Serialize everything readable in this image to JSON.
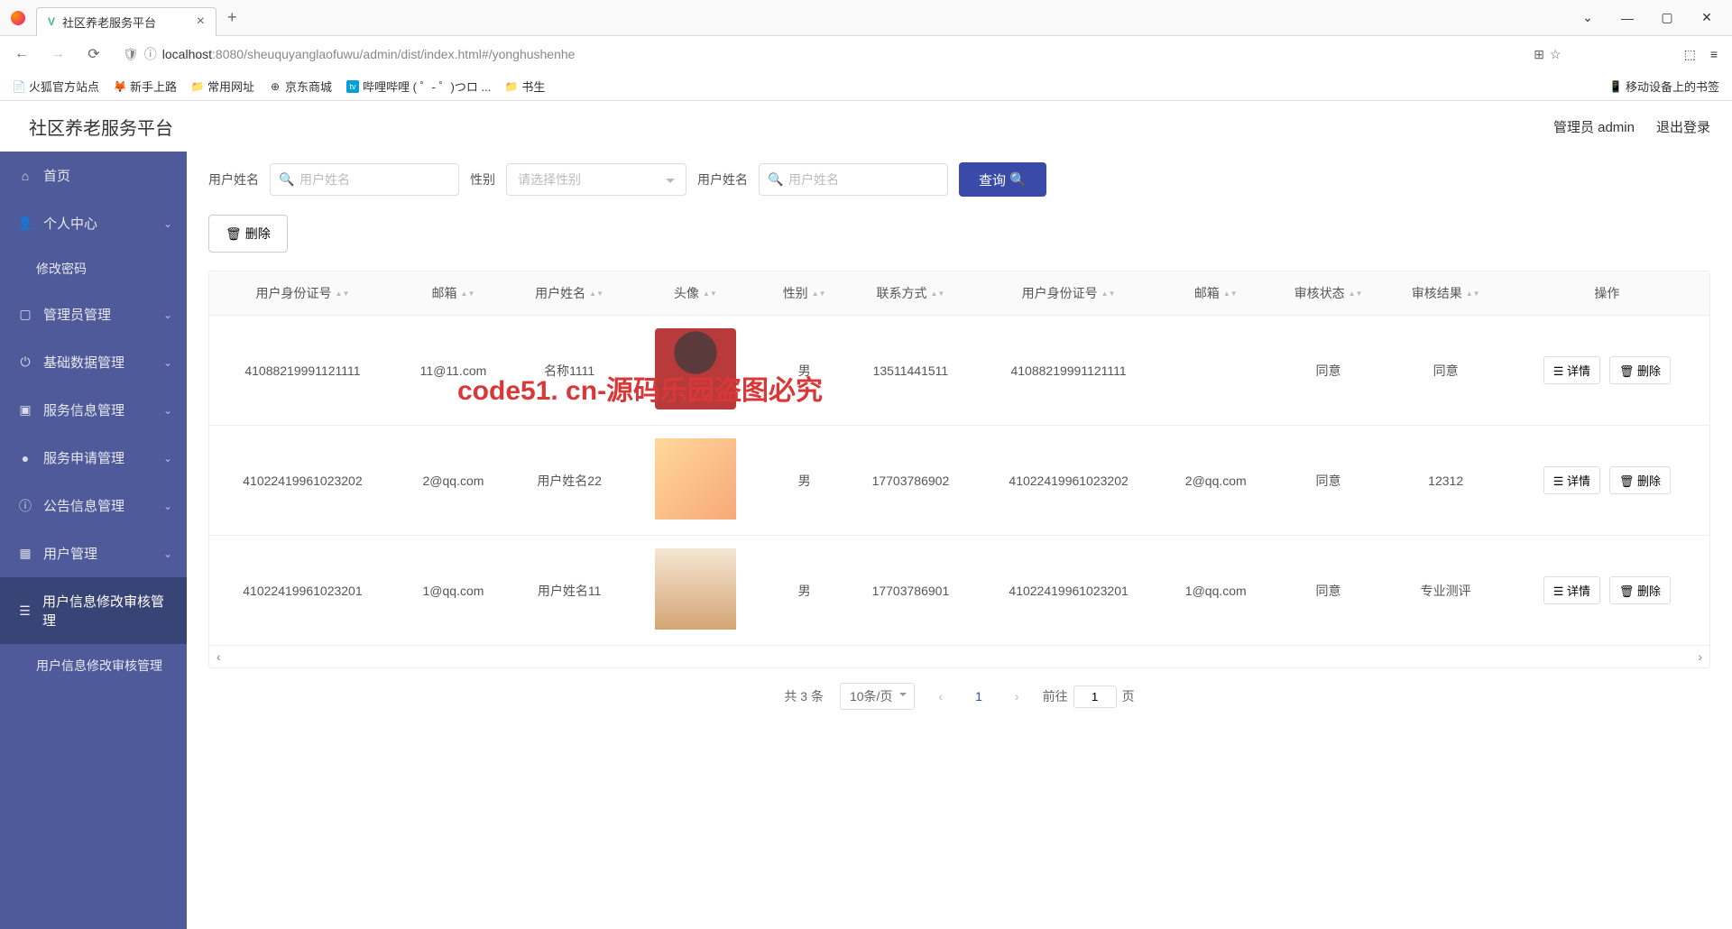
{
  "browser": {
    "tab_title": "社区养老服务平台",
    "url_host": "localhost",
    "url_rest": ":8080/sheuquyanglaofuwu/admin/dist/index.html#/yonghushenhe",
    "bookmarks": [
      "火狐官方站点",
      "新手上路",
      "常用网址",
      "京东商城",
      "哔哩哔哩 ( ゜- ゜)つロ ...",
      "书生"
    ],
    "mobile_bm": "移动设备上的书签"
  },
  "header": {
    "app_title": "社区养老服务平台",
    "admin_label": "管理员 admin",
    "logout": "退出登录"
  },
  "sidebar": {
    "items": [
      {
        "label": "首页",
        "icon": "home"
      },
      {
        "label": "个人中心",
        "icon": "user",
        "expand": true
      },
      {
        "label": "修改密码",
        "sub": true
      },
      {
        "label": "管理员管理",
        "icon": "square",
        "expand": true
      },
      {
        "label": "基础数据管理",
        "icon": "power",
        "expand": true
      },
      {
        "label": "服务信息管理",
        "icon": "box",
        "expand": true
      },
      {
        "label": "服务申请管理",
        "icon": "bulb",
        "expand": true
      },
      {
        "label": "公告信息管理",
        "icon": "info",
        "expand": true
      },
      {
        "label": "用户管理",
        "icon": "grid",
        "expand": true
      },
      {
        "label": "用户信息修改审核管理",
        "icon": "list",
        "active": true
      },
      {
        "label": "用户信息修改审核管理",
        "sub": true
      }
    ]
  },
  "filters": {
    "name_label1": "用户姓名",
    "name_ph1": "用户姓名",
    "sex_label": "性别",
    "sex_ph": "请选择性别",
    "name_label2": "用户姓名",
    "name_ph2": "用户姓名",
    "search_btn": "查询",
    "delete_btn": "删除"
  },
  "table": {
    "headers": [
      "用户身份证号",
      "邮箱",
      "用户姓名",
      "头像",
      "性别",
      "联系方式",
      "用户身份证号",
      "邮箱",
      "审核状态",
      "审核结果",
      "操作"
    ],
    "op_detail": "详情",
    "op_delete": "删除",
    "rows": [
      {
        "id1": "41088219991121111",
        "email1": "11@11.com",
        "name": "名称1111",
        "sex": "男",
        "phone": "13511441511",
        "id2": "41088219991121111",
        "email2": "",
        "status": "同意",
        "result": "同意"
      },
      {
        "id1": "41022419961023202",
        "email1": "2@qq.com",
        "name": "用户姓名22",
        "sex": "男",
        "phone": "17703786902",
        "id2": "41022419961023202",
        "email2": "2@qq.com",
        "status": "同意",
        "result": "12312"
      },
      {
        "id1": "41022419961023201",
        "email1": "1@qq.com",
        "name": "用户姓名11",
        "sex": "男",
        "phone": "17703786901",
        "id2": "41022419961023201",
        "email2": "1@qq.com",
        "status": "同意",
        "result": "专业测评"
      }
    ]
  },
  "pagination": {
    "total": "共 3 条",
    "per_page": "10条/页",
    "current": "1",
    "jump_pre": "前往",
    "jump_val": "1",
    "jump_post": "页"
  },
  "watermark_red": "code51. cn-源码乐园盗图必究"
}
